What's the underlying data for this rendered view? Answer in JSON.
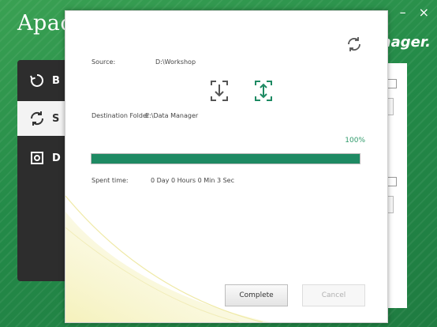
{
  "background_app": {
    "title": "Apac",
    "subtitle": "nager.",
    "window_buttons": [
      "–",
      "×"
    ],
    "sidebar": {
      "items": [
        {
          "label": "B",
          "icon": "backup-icon"
        },
        {
          "label": "S",
          "icon": "sync-icon",
          "active": true
        },
        {
          "label": "D",
          "icon": "disk-icon"
        }
      ]
    }
  },
  "dialog": {
    "source_label": "Source:",
    "source_value": "D:\\Workshop",
    "destination_label": "Destination Folder",
    "destination_value": "E:\\Data Manager",
    "progress_text": "100%",
    "progress_value": 100,
    "spent_time_label": "Spent time:",
    "spent_time_value": "0 Day 0 Hours 0 Min 3 Sec",
    "complete_label": "Complete",
    "cancel_label": "Cancel"
  },
  "colors": {
    "accent_green": "#1e8a63",
    "app_green": "#2f8f4a",
    "sidebar_dark": "#2d2d2d"
  }
}
